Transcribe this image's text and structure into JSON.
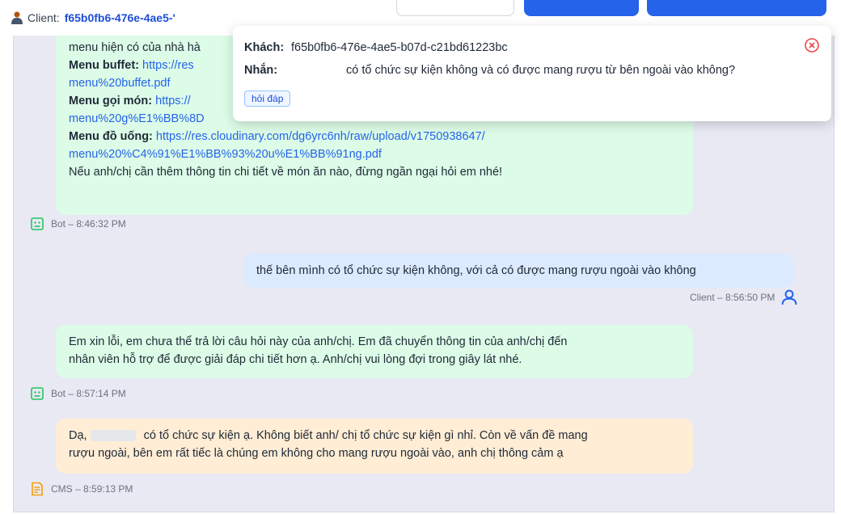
{
  "header": {
    "client_prefix": "Client:",
    "client_id": "f65b0fb6-476e-4ae5-'"
  },
  "popup": {
    "guest_label": "Khách:",
    "guest_value": "f65b0fb6-476e-4ae5-b07d-c21bd61223bc",
    "message_label": "Nhắn:",
    "message_value": "có tổ chức sự kiện không và có được mang rượu từ bên ngoài vào không?",
    "tag": "hỏi đáp"
  },
  "messages": {
    "bot1": {
      "line1": "menu hiện có của nhà hà",
      "buffet_label": "Menu buffet:",
      "buffet_link1": "https://res",
      "buffet_link2": "menu%20buffet.pdf",
      "goimon_label": "Menu gọi món:",
      "goimon_link1": "https://",
      "goimon_link2": "menu%20g%E1%BB%8D",
      "douong_label": "Menu đồ uống:",
      "douong_link1": "https://res.cloudinary.com/dg6yrc6nh/raw/upload/v1750938647/",
      "douong_link2": "menu%20%C4%91%E1%BB%93%20u%E1%BB%91ng.pdf",
      "footer": "Nếu anh/chị cần thêm thông tin chi tiết về món ăn nào, đừng ngần ngại hỏi em nhé!",
      "meta": "Bot – 8:46:32 PM"
    },
    "client1": {
      "text": "thế bên mình có tổ chức sự kiện không, với cả có được mang rượu ngoài vào không",
      "meta": "Client – 8:56:50 PM"
    },
    "bot2": {
      "line1": "Em xin lỗi, em chưa thể trả lời câu hỏi này của anh/chị. Em đã chuyển thông tin của anh/chị đến",
      "line2": "nhân viên hỗ trợ để được giải đáp chi tiết hơn ạ. Anh/chị vui lòng đợi trong giây lát nhé.",
      "meta": "Bot – 8:57:14 PM"
    },
    "cms1": {
      "prefix": "Dạ,",
      "line1": "có tổ chức sự kiện ạ. Không biết anh/ chị tổ chức sự kiện gì nhỉ. Còn về vấn đề mang",
      "line2": "rượu ngoài, bên em rất tiếc là chúng em không cho mang rượu ngoài vào, anh chị thông cảm ạ",
      "meta": "CMS – 8:59:13 PM"
    }
  },
  "icons": {
    "client_header": "person-icon",
    "bot": "robot-icon",
    "client": "user-icon",
    "cms": "document-icon",
    "close": "close-circle-icon"
  },
  "colors": {
    "bot_bubble": "#dcfce7",
    "client_bubble": "#dbeafe",
    "cms_bubble": "#ffedd5",
    "accent": "#2563eb"
  }
}
